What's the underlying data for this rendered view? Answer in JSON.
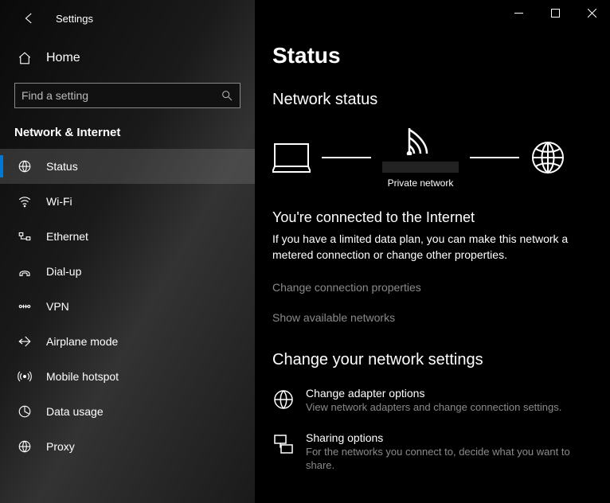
{
  "app": {
    "title": "Settings"
  },
  "sidebar": {
    "home": "Home",
    "search_placeholder": "Find a setting",
    "category": "Network & Internet",
    "items": [
      {
        "label": "Status"
      },
      {
        "label": "Wi-Fi"
      },
      {
        "label": "Ethernet"
      },
      {
        "label": "Dial-up"
      },
      {
        "label": "VPN"
      },
      {
        "label": "Airplane mode"
      },
      {
        "label": "Mobile hotspot"
      },
      {
        "label": "Data usage"
      },
      {
        "label": "Proxy"
      }
    ]
  },
  "page": {
    "title": "Status",
    "network_status": "Network status",
    "network_type": "Private network",
    "connected_heading": "You're connected to the Internet",
    "connected_desc": "If you have a limited data plan, you can make this network a metered connection or change other properties.",
    "link_change_props": "Change connection properties",
    "link_show_networks": "Show available networks",
    "change_settings": "Change your network settings",
    "options": [
      {
        "title": "Change adapter options",
        "desc": "View network adapters and change connection settings."
      },
      {
        "title": "Sharing options",
        "desc": "For the networks you connect to, decide what you want to share."
      }
    ]
  },
  "annotation": {
    "arrow_color": "#ff0000"
  }
}
